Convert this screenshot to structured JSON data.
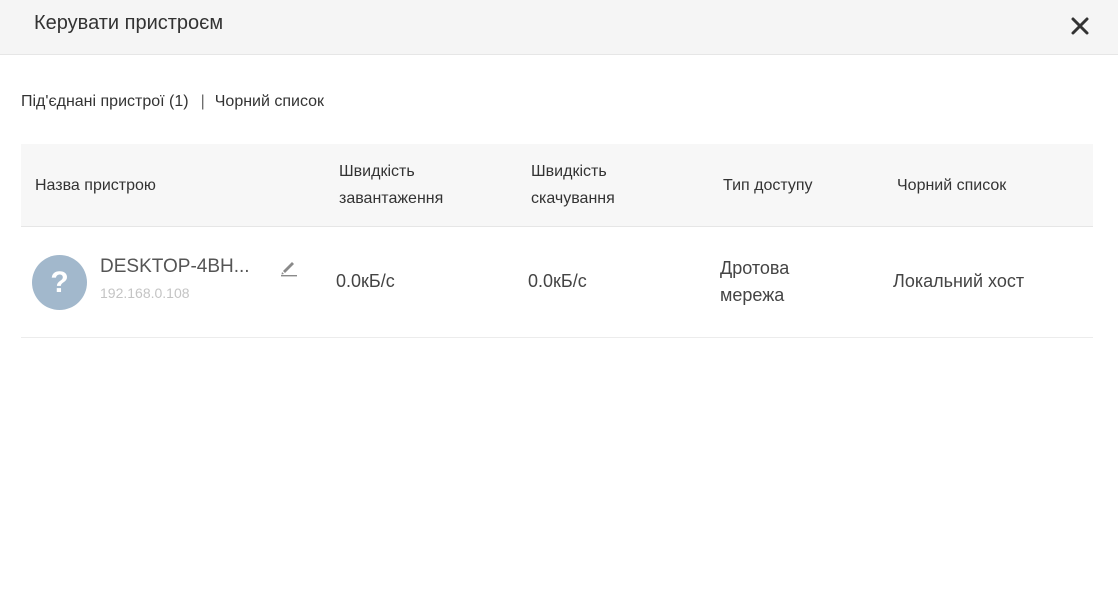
{
  "dialog": {
    "title": "Керувати пристроєм",
    "close_icon": "close-icon"
  },
  "tabs": {
    "connected": "Під'єднані пристрої (1)",
    "separator": "|",
    "blacklist": "Чорний список"
  },
  "table": {
    "columns": {
      "name": "Назва пристрою",
      "upload": "Швидкість завантаження",
      "download": "Швидкість скачування",
      "access": "Тип доступу",
      "blacklist": "Чорний список"
    },
    "rows": [
      {
        "avatar": "?",
        "name": "DESKTOP-4BH...",
        "ip": "192.168.0.108",
        "upload": "0.0кБ/с",
        "download": "0.0кБ/с",
        "access": "Дротова мережа",
        "blacklist": "Локальний хост"
      }
    ]
  },
  "colors": {
    "header_bg": "#f5f5f5",
    "avatar_bg": "#a2b8cc",
    "ip_text": "#c4c4c4"
  }
}
